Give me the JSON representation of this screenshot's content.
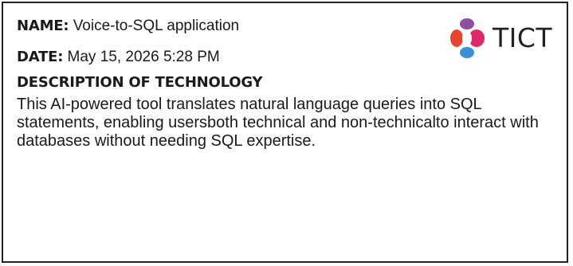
{
  "fields": {
    "name_label": "NAME:",
    "name_value": "Voice-to-SQL application",
    "date_label": "DATE:",
    "date_value": "May 15, 2026 5:28 PM"
  },
  "description": {
    "heading": "DESCRIPTION OF TECHNOLOGY",
    "lines": [
      "This AI-powered tool translates natural language queries into SQL",
      "statements, enabling usersboth technical and non-technicalto interact with",
      "databases without needing SQL expertise."
    ]
  },
  "logo": {
    "text": "TICT",
    "icon": "tict-logo-icon",
    "colors": {
      "top": "#8e4fa0",
      "left": "#e8442e",
      "right": "#e0296b",
      "bottom": "#3a8fd6"
    }
  }
}
